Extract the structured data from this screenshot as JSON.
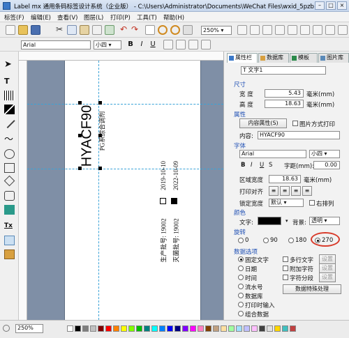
{
  "window": {
    "title": "Label mx 通用条码标签设计系统（企业版） - C:\\Users\\Administrator\\Documents\\WeChat Files\\wxid_5pzb"
  },
  "menu": [
    "标签(F)",
    "编辑(E)",
    "查看(V)",
    "图层(L)",
    "打印(P)",
    "工具(T)",
    "帮助(H)"
  ],
  "toolbar": {
    "zoom": "250%"
  },
  "fontbar": {
    "font": "Arial",
    "size": "小四"
  },
  "canvas": {
    "main_text": "HYACF90",
    "sub_text": "PG系综合调剂",
    "date1": "2019-10-10",
    "date2": "2022-10-09",
    "batch": "生产批号: 19002",
    "batch2": "灭菌批号: 19002"
  },
  "panel": {
    "tabs": [
      "属性栏",
      "数据库",
      "模板",
      "图片库"
    ],
    "object_select": "T 文字1",
    "size_section": "尺寸",
    "width_label": "宽  度",
    "width_value": "5.43",
    "height_label": "高  度",
    "height_value": "18.63",
    "unit": "毫米(mm)",
    "attr_section": "属性",
    "content_button": "内容属性(S)",
    "image_print_label": "图片方式打印",
    "content_label": "内容:",
    "content_value": "HYACF90",
    "font_section": "字体",
    "font_name": "Arial",
    "font_size": "小四",
    "spacing_label": "字距(mm):",
    "spacing_value": "0.00",
    "region_width_label": "区域宽度",
    "region_width_value": "18.63",
    "region_unit": "毫米(mm)",
    "align_label": "打印对齐",
    "lock_label": "锁定宽度",
    "lock_value": "默认",
    "right_arrange": "右排列",
    "color_section": "颜色",
    "text_color_label": "文字:",
    "bg_label": "背景:",
    "bg_value": "透明",
    "rotate_section": "旋转",
    "rotations": [
      "0",
      "90",
      "180",
      "270"
    ],
    "rotation_selected": "270",
    "data_section": "数据选项",
    "data_options": [
      "固定文字",
      "日期",
      "时间",
      "流水号",
      "数据库",
      "打印时输入",
      "组合数据"
    ],
    "data_checks": [
      "多行文字",
      "附加字符",
      "字符分段"
    ],
    "setting_label": "设置",
    "special_button": "数据特殊处理"
  },
  "status": {
    "zoom": "250%"
  },
  "colors": {
    "accent": "#1e4fb4",
    "highlight_circle": "#d83a2a",
    "guide": "#3aa3d8"
  }
}
